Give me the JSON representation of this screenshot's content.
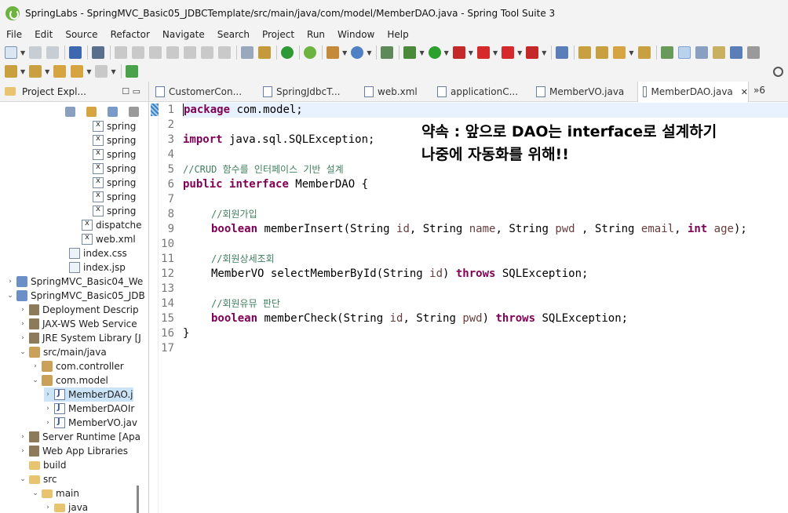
{
  "window": {
    "title": "SpringLabs - SpringMVC_Basic05_JDBCTemplate/src/main/java/com/model/MemberDAO.java - Spring Tool Suite 3"
  },
  "menu": [
    "File",
    "Edit",
    "Source",
    "Refactor",
    "Navigate",
    "Search",
    "Project",
    "Run",
    "Window",
    "Help"
  ],
  "project_explorer": {
    "tab_label": "Project Expl...",
    "controls": "☐ ▭",
    "tree": [
      {
        "label": "spring",
        "type": "xml"
      },
      {
        "label": "spring",
        "type": "xml"
      },
      {
        "label": "spring",
        "type": "xml"
      },
      {
        "label": "spring",
        "type": "xml"
      },
      {
        "label": "spring",
        "type": "xml"
      },
      {
        "label": "spring",
        "type": "xml"
      },
      {
        "label": "spring",
        "type": "xml"
      },
      {
        "label": "dispatche",
        "type": "xml"
      },
      {
        "label": "web.xml",
        "type": "xml"
      },
      {
        "label": "index.css",
        "type": "file"
      },
      {
        "label": "index.jsp",
        "type": "file"
      },
      {
        "label": "SpringMVC_Basic04_We",
        "type": "proj"
      },
      {
        "label": "SpringMVC_Basic05_JDB",
        "type": "proj"
      },
      {
        "label": "Deployment Descrip",
        "type": "lib"
      },
      {
        "label": "JAX-WS Web Service",
        "type": "lib"
      },
      {
        "label": "JRE System Library [J",
        "type": "lib"
      },
      {
        "label": "src/main/java",
        "type": "pkg"
      },
      {
        "label": "com.controller",
        "type": "pkg"
      },
      {
        "label": "com.model",
        "type": "pkg"
      },
      {
        "label": "MemberDAO.j",
        "type": "java"
      },
      {
        "label": "MemberDAOIr",
        "type": "java"
      },
      {
        "label": "MemberVO.jav",
        "type": "java"
      },
      {
        "label": "Server Runtime [Apa",
        "type": "lib"
      },
      {
        "label": "Web App Libraries",
        "type": "lib"
      },
      {
        "label": "build",
        "type": "folder"
      },
      {
        "label": "src",
        "type": "folder"
      },
      {
        "label": "main",
        "type": "folder"
      },
      {
        "label": "java",
        "type": "folder"
      }
    ]
  },
  "editor_tabs": [
    {
      "label": "CustomerCon...",
      "active": false
    },
    {
      "label": "SpringJdbcT...",
      "active": false
    },
    {
      "label": "web.xml",
      "active": false
    },
    {
      "label": "applicationC...",
      "active": false
    },
    {
      "label": "MemberVO.java",
      "active": false
    },
    {
      "label": "MemberDAO.java",
      "active": true
    }
  ],
  "editor_tabs_close": "✕",
  "tab_overflow": "»6",
  "code": {
    "line_numbers": [
      "1",
      "2",
      "3",
      "4",
      "5",
      "6",
      "7",
      "8",
      "9",
      "10",
      "11",
      "12",
      "13",
      "14",
      "15",
      "16",
      "17"
    ],
    "l1_kw": "package",
    "l1_rest": " com.model;",
    "l3_kw": "import",
    "l3_rest": " java.sql.SQLException;",
    "l5_comment": "//CRUD 함수를 인터페이스 기반 설계",
    "l6_kw1": "public",
    "l6_kw2": "interface",
    "l6_rest": " MemberDAO {",
    "l8_comment": "//회원가입",
    "l9_kw": "boolean",
    "l9_a": " memberInsert(String ",
    "l9_p1": "id",
    "l9_b": ", String ",
    "l9_p2": "name",
    "l9_c": ", String ",
    "l9_p3": "pwd",
    "l9_d": " , String ",
    "l9_p4": "email",
    "l9_e": ", ",
    "l9_kw2": "int",
    "l9_f": " ",
    "l9_p5": "age",
    "l9_g": ");",
    "l11_comment": "//회원상세조회",
    "l12_a": "MemberVO selectMemberById(String ",
    "l12_p1": "id",
    "l12_b": ") ",
    "l12_kw": "throws",
    "l12_c": " SQLException;",
    "l14_comment": "//회원유뮤 판단",
    "l15_kw": "boolean",
    "l15_a": " memberCheck(String ",
    "l15_p1": "id",
    "l15_b": ", String ",
    "l15_p2": "pwd",
    "l15_c": ") ",
    "l15_kw2": "throws",
    "l15_d": " SQLException;",
    "l16": "}"
  },
  "annotation": {
    "line1": "약속 : 앞으로 DAO는 interface로 설계하기",
    "line2": "나중에 자동화를 위해!!"
  },
  "colors": {
    "keyword": "#7f0055",
    "comment": "#3f7f5f",
    "parameter": "#6a3e3e",
    "selection": "#cce4f7"
  }
}
